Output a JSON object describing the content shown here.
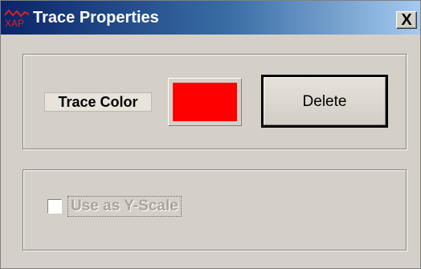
{
  "window": {
    "title": "Trace Properties",
    "icon": "xap-app-icon",
    "icon_text": "XAP",
    "close_glyph": "X"
  },
  "trace": {
    "color_label": "Trace Color",
    "color_value": "#ff0000",
    "delete_label": "Delete"
  },
  "options": {
    "y_scale_label": "Use as Y-Scale",
    "y_scale_checked": false,
    "y_scale_enabled": false
  },
  "colors": {
    "titlebar_start": "#0a246a",
    "titlebar_end": "#a6caf0",
    "face": "#d4d0c8"
  }
}
